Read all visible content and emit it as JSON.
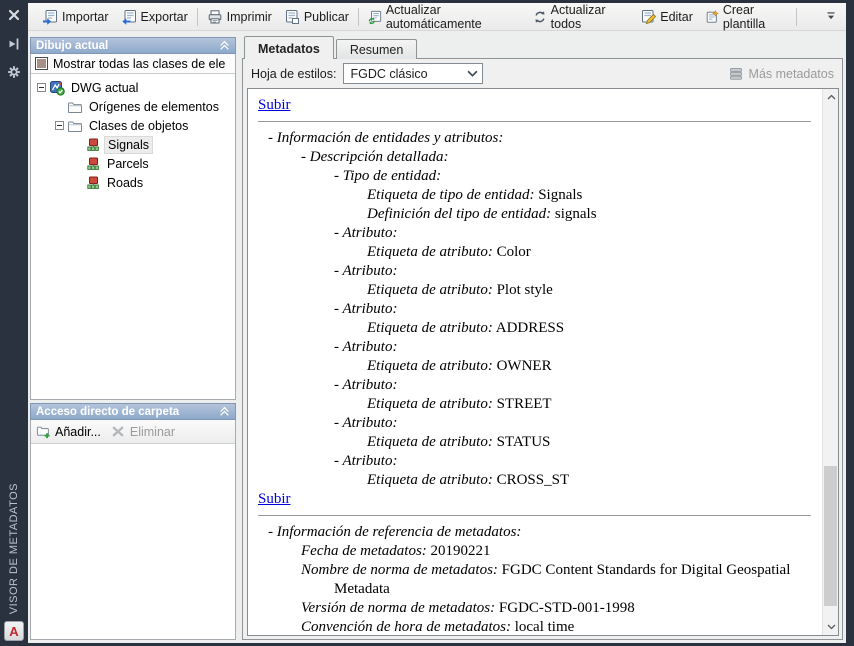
{
  "window": {
    "vertical_title": "VISOR DE METADATOS",
    "logo_letter": "A"
  },
  "strip_icons": {
    "close": "close-icon",
    "pin": "auto-hide-pin-icon",
    "gear": "properties-gear-icon"
  },
  "toolbar": {
    "buttons": [
      {
        "label": "Importar",
        "icon": "import-icon"
      },
      {
        "label": "Exportar",
        "icon": "export-icon"
      },
      {
        "label": "Imprimir",
        "icon": "print-icon"
      },
      {
        "label": "Publicar",
        "icon": "publish-icon"
      },
      {
        "label": "Actualizar automáticamente",
        "icon": "auto-update-icon"
      },
      {
        "label": "Actualizar todos",
        "icon": "update-all-icon"
      },
      {
        "label": "Editar",
        "icon": "edit-icon"
      },
      {
        "label": "Crear plantilla",
        "icon": "create-template-icon"
      }
    ],
    "overflow_icon": "toolbar-overflow-icon"
  },
  "left": {
    "panel1": {
      "title": "Dibujo actual",
      "checkbox_label": "Mostrar todas las clases de ele",
      "tree": [
        {
          "label": "DWG actual",
          "icon": "dwg-icon",
          "level": 0,
          "expanded": true
        },
        {
          "label": "Orígenes de elementos",
          "icon": "folder-icon",
          "level": 1
        },
        {
          "label": "Clases de objetos",
          "icon": "folder-icon",
          "level": 1,
          "expanded": true
        },
        {
          "label": "Signals",
          "icon": "object-class-icon",
          "level": 2,
          "selected": true
        },
        {
          "label": "Parcels",
          "icon": "object-class-icon",
          "level": 2
        },
        {
          "label": "Roads",
          "icon": "object-class-icon",
          "level": 2
        }
      ]
    },
    "panel2": {
      "title": "Acceso directo de carpeta",
      "add_label": "Añadir...",
      "remove_label": "Eliminar"
    }
  },
  "main": {
    "tabs": [
      {
        "label": "Metadatos",
        "active": true
      },
      {
        "label": "Resumen",
        "active": false
      }
    ],
    "stylesheet": {
      "label": "Hoja de estilos:",
      "value": "FGDC clásico"
    },
    "more_metadata_label": "Más metadatos",
    "document": {
      "lines": [
        {
          "type": "link",
          "text": "Subir"
        },
        {
          "type": "hr"
        },
        {
          "ind": 0,
          "label": "- Información de entidades y atributos:"
        },
        {
          "ind": 1,
          "label": "- Descripción detallada:"
        },
        {
          "ind": 2,
          "label": "- Tipo de entidad:"
        },
        {
          "ind": 3,
          "label": "Etiqueta de tipo de entidad:",
          "value": "Signals"
        },
        {
          "ind": 3,
          "label": "Definición del tipo de entidad:",
          "value": "signals"
        },
        {
          "ind": 2,
          "label": "- Atributo:"
        },
        {
          "ind": 3,
          "label": "Etiqueta de atributo:",
          "value": "Color"
        },
        {
          "ind": 2,
          "label": "- Atributo:"
        },
        {
          "ind": 3,
          "label": "Etiqueta de atributo:",
          "value": "Plot style"
        },
        {
          "ind": 2,
          "label": "- Atributo:"
        },
        {
          "ind": 3,
          "label": "Etiqueta de atributo:",
          "value": "ADDRESS"
        },
        {
          "ind": 2,
          "label": "- Atributo:"
        },
        {
          "ind": 3,
          "label": "Etiqueta de atributo:",
          "value": "OWNER"
        },
        {
          "ind": 2,
          "label": "- Atributo:"
        },
        {
          "ind": 3,
          "label": "Etiqueta de atributo:",
          "value": "STREET"
        },
        {
          "ind": 2,
          "label": "- Atributo:"
        },
        {
          "ind": 3,
          "label": "Etiqueta de atributo:",
          "value": "STATUS"
        },
        {
          "ind": 2,
          "label": "- Atributo:"
        },
        {
          "ind": 3,
          "label": "Etiqueta de atributo:",
          "value": "CROSS_ST"
        },
        {
          "type": "link",
          "text": "Subir"
        },
        {
          "type": "hr"
        },
        {
          "ind": 0,
          "label": "- Información de referencia de metadatos:"
        },
        {
          "ind": 1,
          "label": "Fecha de metadatos:",
          "value": "20190221"
        },
        {
          "ind": 1,
          "label": "Nombre de norma de metadatos:",
          "value": "FGDC Content Standards for Digital Geospatial"
        },
        {
          "ind": 2,
          "value": "Metadata"
        },
        {
          "ind": 1,
          "label": "Versión de norma de metadatos:",
          "value": "FGDC-STD-001-1998"
        },
        {
          "ind": 1,
          "label": "Convención de hora de metadatos:",
          "value": "local time"
        }
      ]
    }
  },
  "colors": {
    "frame": "#29323e",
    "panel_header": "#94afd0",
    "link": "#0000dd",
    "selection": "#ececec",
    "disabled_text": "#9b9b9b",
    "accent_green": "#2f9e3f",
    "accent_blue": "#2a6cd5"
  }
}
